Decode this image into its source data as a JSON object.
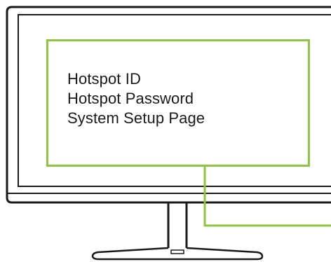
{
  "callout": {
    "lines": [
      "Hotspot ID",
      "Hotspot Password",
      "System Setup Page"
    ]
  },
  "colors": {
    "outline": "#1a1a1a",
    "highlight": "#8dc63f",
    "background": "#ffffff"
  },
  "icons": {
    "monitor": "monitor-icon",
    "stand": "monitor-stand-icon"
  }
}
